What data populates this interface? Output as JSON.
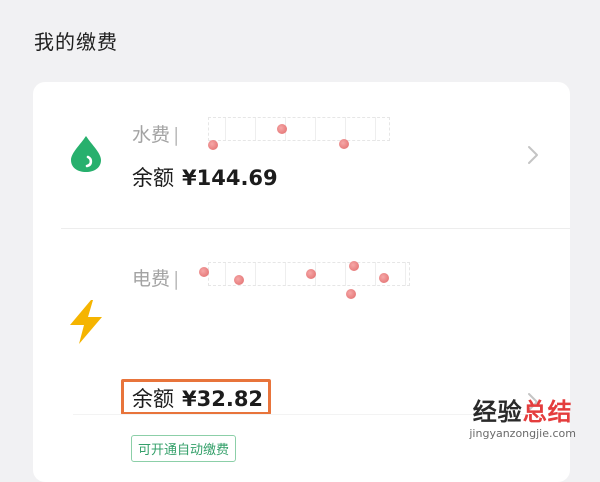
{
  "page": {
    "title": "我的缴费"
  },
  "water": {
    "name": "水费",
    "separator": "|",
    "balance_label": "余额",
    "balance_value": "¥144.69",
    "icon": "water-drop-icon",
    "color": "#27b06d"
  },
  "electricity": {
    "name": "电费",
    "separator": "|",
    "balance_label": "余额",
    "balance_value": "¥32.82",
    "auto_pay_label": "可开通自动缴费",
    "icon": "lightning-bolt-icon",
    "color": "#f5b400"
  },
  "highlight_color": "#e8743b",
  "watermark": {
    "main_prefix": "经验",
    "main_accent": "总结",
    "sub": "jingyanzongjie.com"
  }
}
